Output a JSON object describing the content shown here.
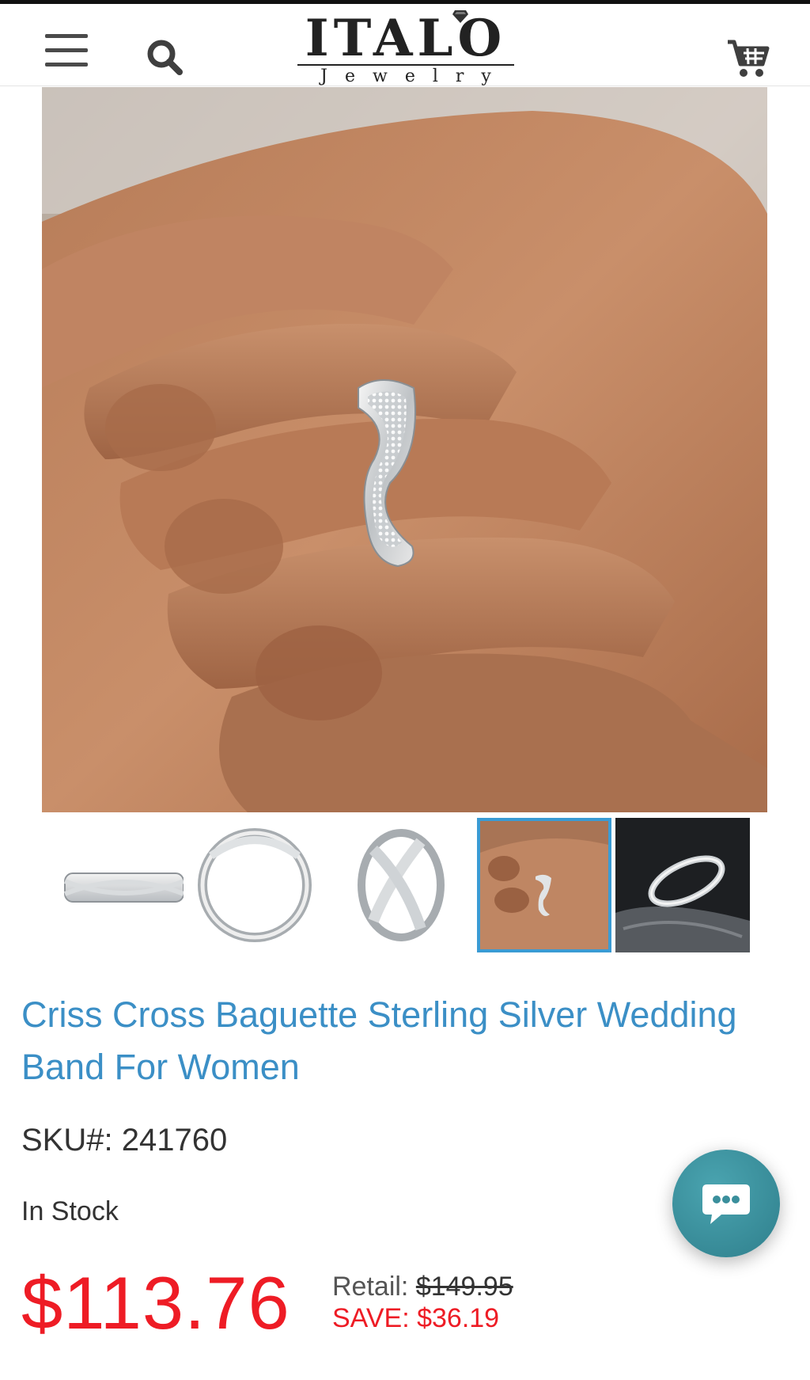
{
  "header": {
    "logo_main": "ITALO",
    "logo_sub": "Jewelry",
    "menu_icon": "hamburger-menu-icon",
    "search_icon": "search-icon",
    "cart_icon": "cart-icon"
  },
  "gallery": {
    "thumbnails": [
      {
        "name": "ring-front-view",
        "active": false
      },
      {
        "name": "ring-side-profile",
        "active": false
      },
      {
        "name": "ring-angled-view",
        "active": false
      },
      {
        "name": "ring-on-hand",
        "active": true
      },
      {
        "name": "ring-on-dark-stone",
        "active": false
      }
    ]
  },
  "product": {
    "title": "Criss Cross Baguette Sterling Silver Wedding Band For Women",
    "sku_label": "SKU#:",
    "sku_value": "241760",
    "stock": "In Stock",
    "price": "$113.76",
    "retail_label": "Retail:",
    "retail_value": "$149.95",
    "save_label": "SAVE:",
    "save_value": "$36.19"
  },
  "chat": {
    "icon": "chat-bubble-icon"
  },
  "colors": {
    "title": "#3b8fc6",
    "price": "#ee1c25",
    "active_thumb_border": "#3a9bd4",
    "chat_button": "#3a8f9c"
  }
}
